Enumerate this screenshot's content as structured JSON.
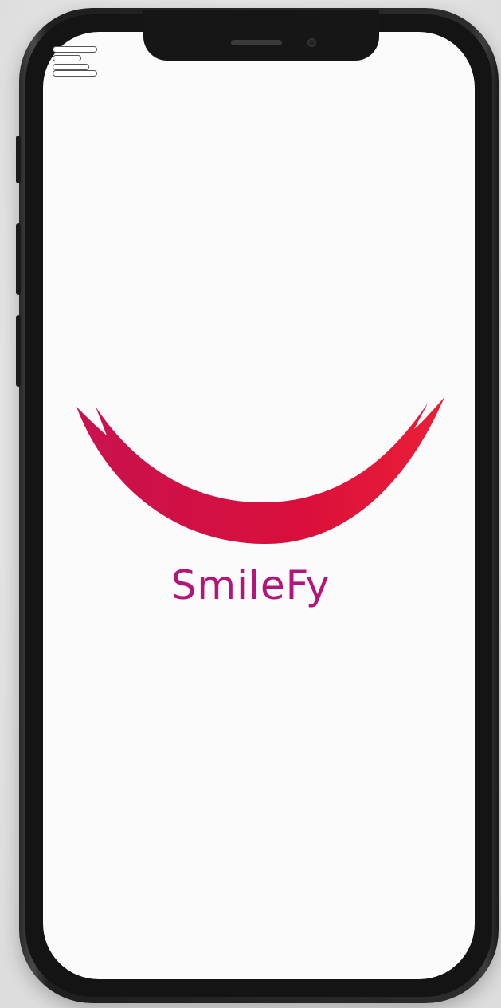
{
  "app": {
    "brand_name": "SmileFy",
    "brand_color": "#b5157a",
    "logo_color": "#d6133f"
  },
  "screen": {
    "menu_icon": "hamburger-menu-icon"
  }
}
